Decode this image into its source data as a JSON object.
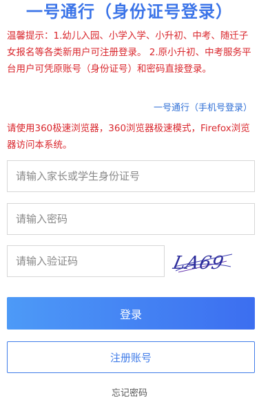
{
  "header": {
    "title": "一号通行（身份证号登录）"
  },
  "notice": {
    "text": "温馨提示：1.幼儿入园、小学入学、小升初、中考、随迁子女报名等各类新用户可注册登录。 2.原小升初、中考服务平台用户可凭原账号（身份证号）和密码直接登录。"
  },
  "alt_login": {
    "label": "一号通行（手机号登录）"
  },
  "browser_tip": {
    "text": "请使用360极速浏览器，360浏览器极速模式，Firefox浏览器访问本系统。"
  },
  "form": {
    "id_placeholder": "请输入家长或学生身份证号",
    "id_value": "",
    "password_placeholder": "请输入密码",
    "password_value": "",
    "captcha_placeholder": "请输入验证码",
    "captcha_value": "",
    "captcha_text": "LA69"
  },
  "actions": {
    "login_label": "登录",
    "register_label": "注册账号",
    "forgot_label": "忘记密码"
  },
  "colors": {
    "title": "#3b74e8",
    "notice": "#d9262c",
    "link": "#2f6fd6",
    "button_gradient_start": "#4d9af7",
    "button_gradient_end": "#3c6ef0",
    "register_border": "#3f7be8"
  }
}
